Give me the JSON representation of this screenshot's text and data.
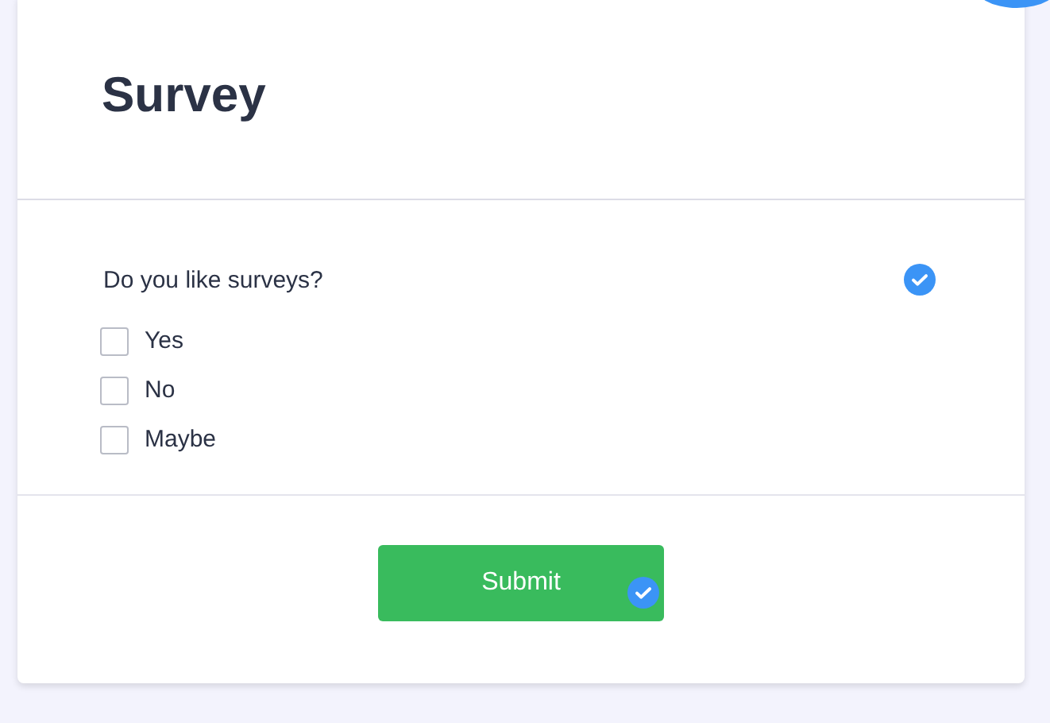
{
  "title": "Survey",
  "question": {
    "text": "Do you like surveys?",
    "answered": true,
    "options": [
      {
        "label": "Yes",
        "checked": false
      },
      {
        "label": "No",
        "checked": false
      },
      {
        "label": "Maybe",
        "checked": false
      }
    ]
  },
  "submit": {
    "label": "Submit",
    "valid": true
  }
}
